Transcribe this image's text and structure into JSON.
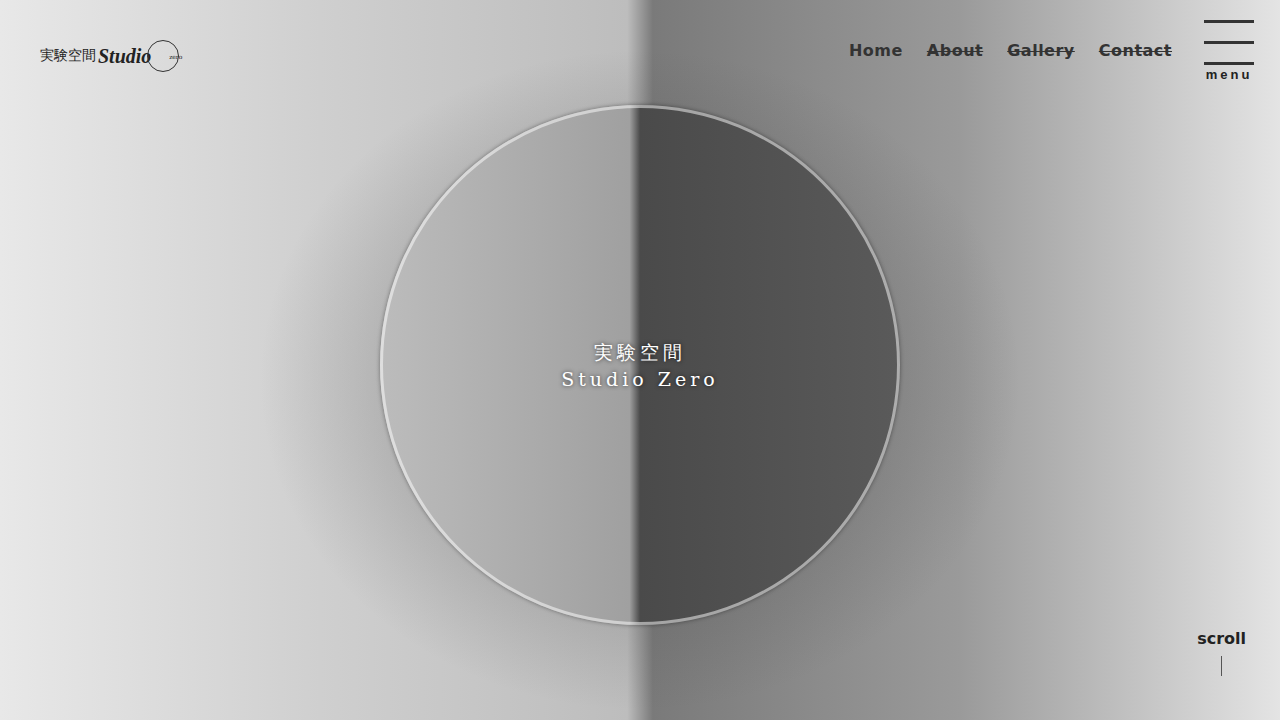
{
  "logo": {
    "jp": "実験空間",
    "en": "Studio",
    "mark": "zero"
  },
  "nav": [
    {
      "label": "Home",
      "disabled": false
    },
    {
      "label": "About",
      "disabled": true
    },
    {
      "label": "Gallery",
      "disabled": true
    },
    {
      "label": "Contact",
      "disabled": true
    }
  ],
  "menu_button": {
    "label": "menu"
  },
  "hero": {
    "title_jp": "実験空間",
    "title_en": "Studio Zero"
  },
  "scroll": {
    "label": "scroll"
  }
}
